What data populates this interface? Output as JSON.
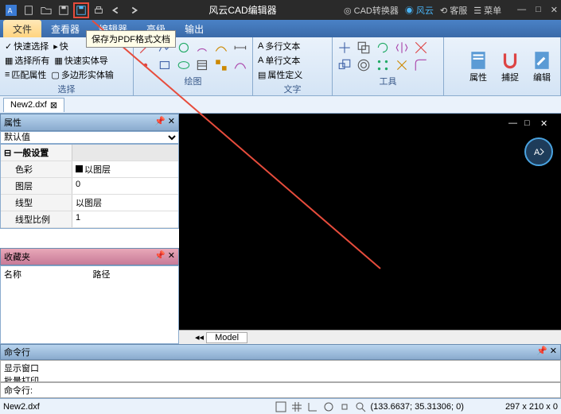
{
  "titlebar": {
    "app_title": "风云CAD编辑器",
    "right": {
      "converter": "CAD转换器",
      "fengyun": "风云",
      "support": "客服",
      "menu": "菜单"
    }
  },
  "tooltip": "保存为PDF格式文档",
  "menu": {
    "file": "文件",
    "viewer": "查看器",
    "editor": "编辑器",
    "advanced": "高级",
    "output": "输出"
  },
  "ribbon": {
    "sel": {
      "quick": "快速选择",
      "all": "选择所有",
      "match": "匹配属性",
      "quickv": "快",
      "entity": "快速实体导",
      "poly": "多边形实体输",
      "label": "选择"
    },
    "draw_label": "绘图",
    "text": {
      "mtext": "多行文本",
      "stext": "单行文本",
      "propdef": "属性定义",
      "label": "文字"
    },
    "tool_label": "工具",
    "prop_btn": "属性",
    "snap_btn": "捕捉",
    "edit_btn": "编辑"
  },
  "tab": {
    "name": "New2.dxf"
  },
  "props": {
    "header": "属性",
    "combo": "默认值",
    "group": "一般设置",
    "rows": [
      {
        "k": "色彩",
        "v": "■以图层"
      },
      {
        "k": "图层",
        "v": "0"
      },
      {
        "k": "线型",
        "v": "以图层"
      },
      {
        "k": "线型比例",
        "v": "1"
      }
    ]
  },
  "fav": {
    "header": "收藏夹",
    "col1": "名称",
    "col2": "路径"
  },
  "model_tab": "Model",
  "cmd": {
    "header": "命令行",
    "h1": "显示窗口",
    "h2": "批量打印",
    "prompt": "命令行:"
  },
  "status": {
    "file": "New2.dxf",
    "coords": "(133.6637; 35.31306; 0)",
    "size": "297 x 210 x 0"
  }
}
